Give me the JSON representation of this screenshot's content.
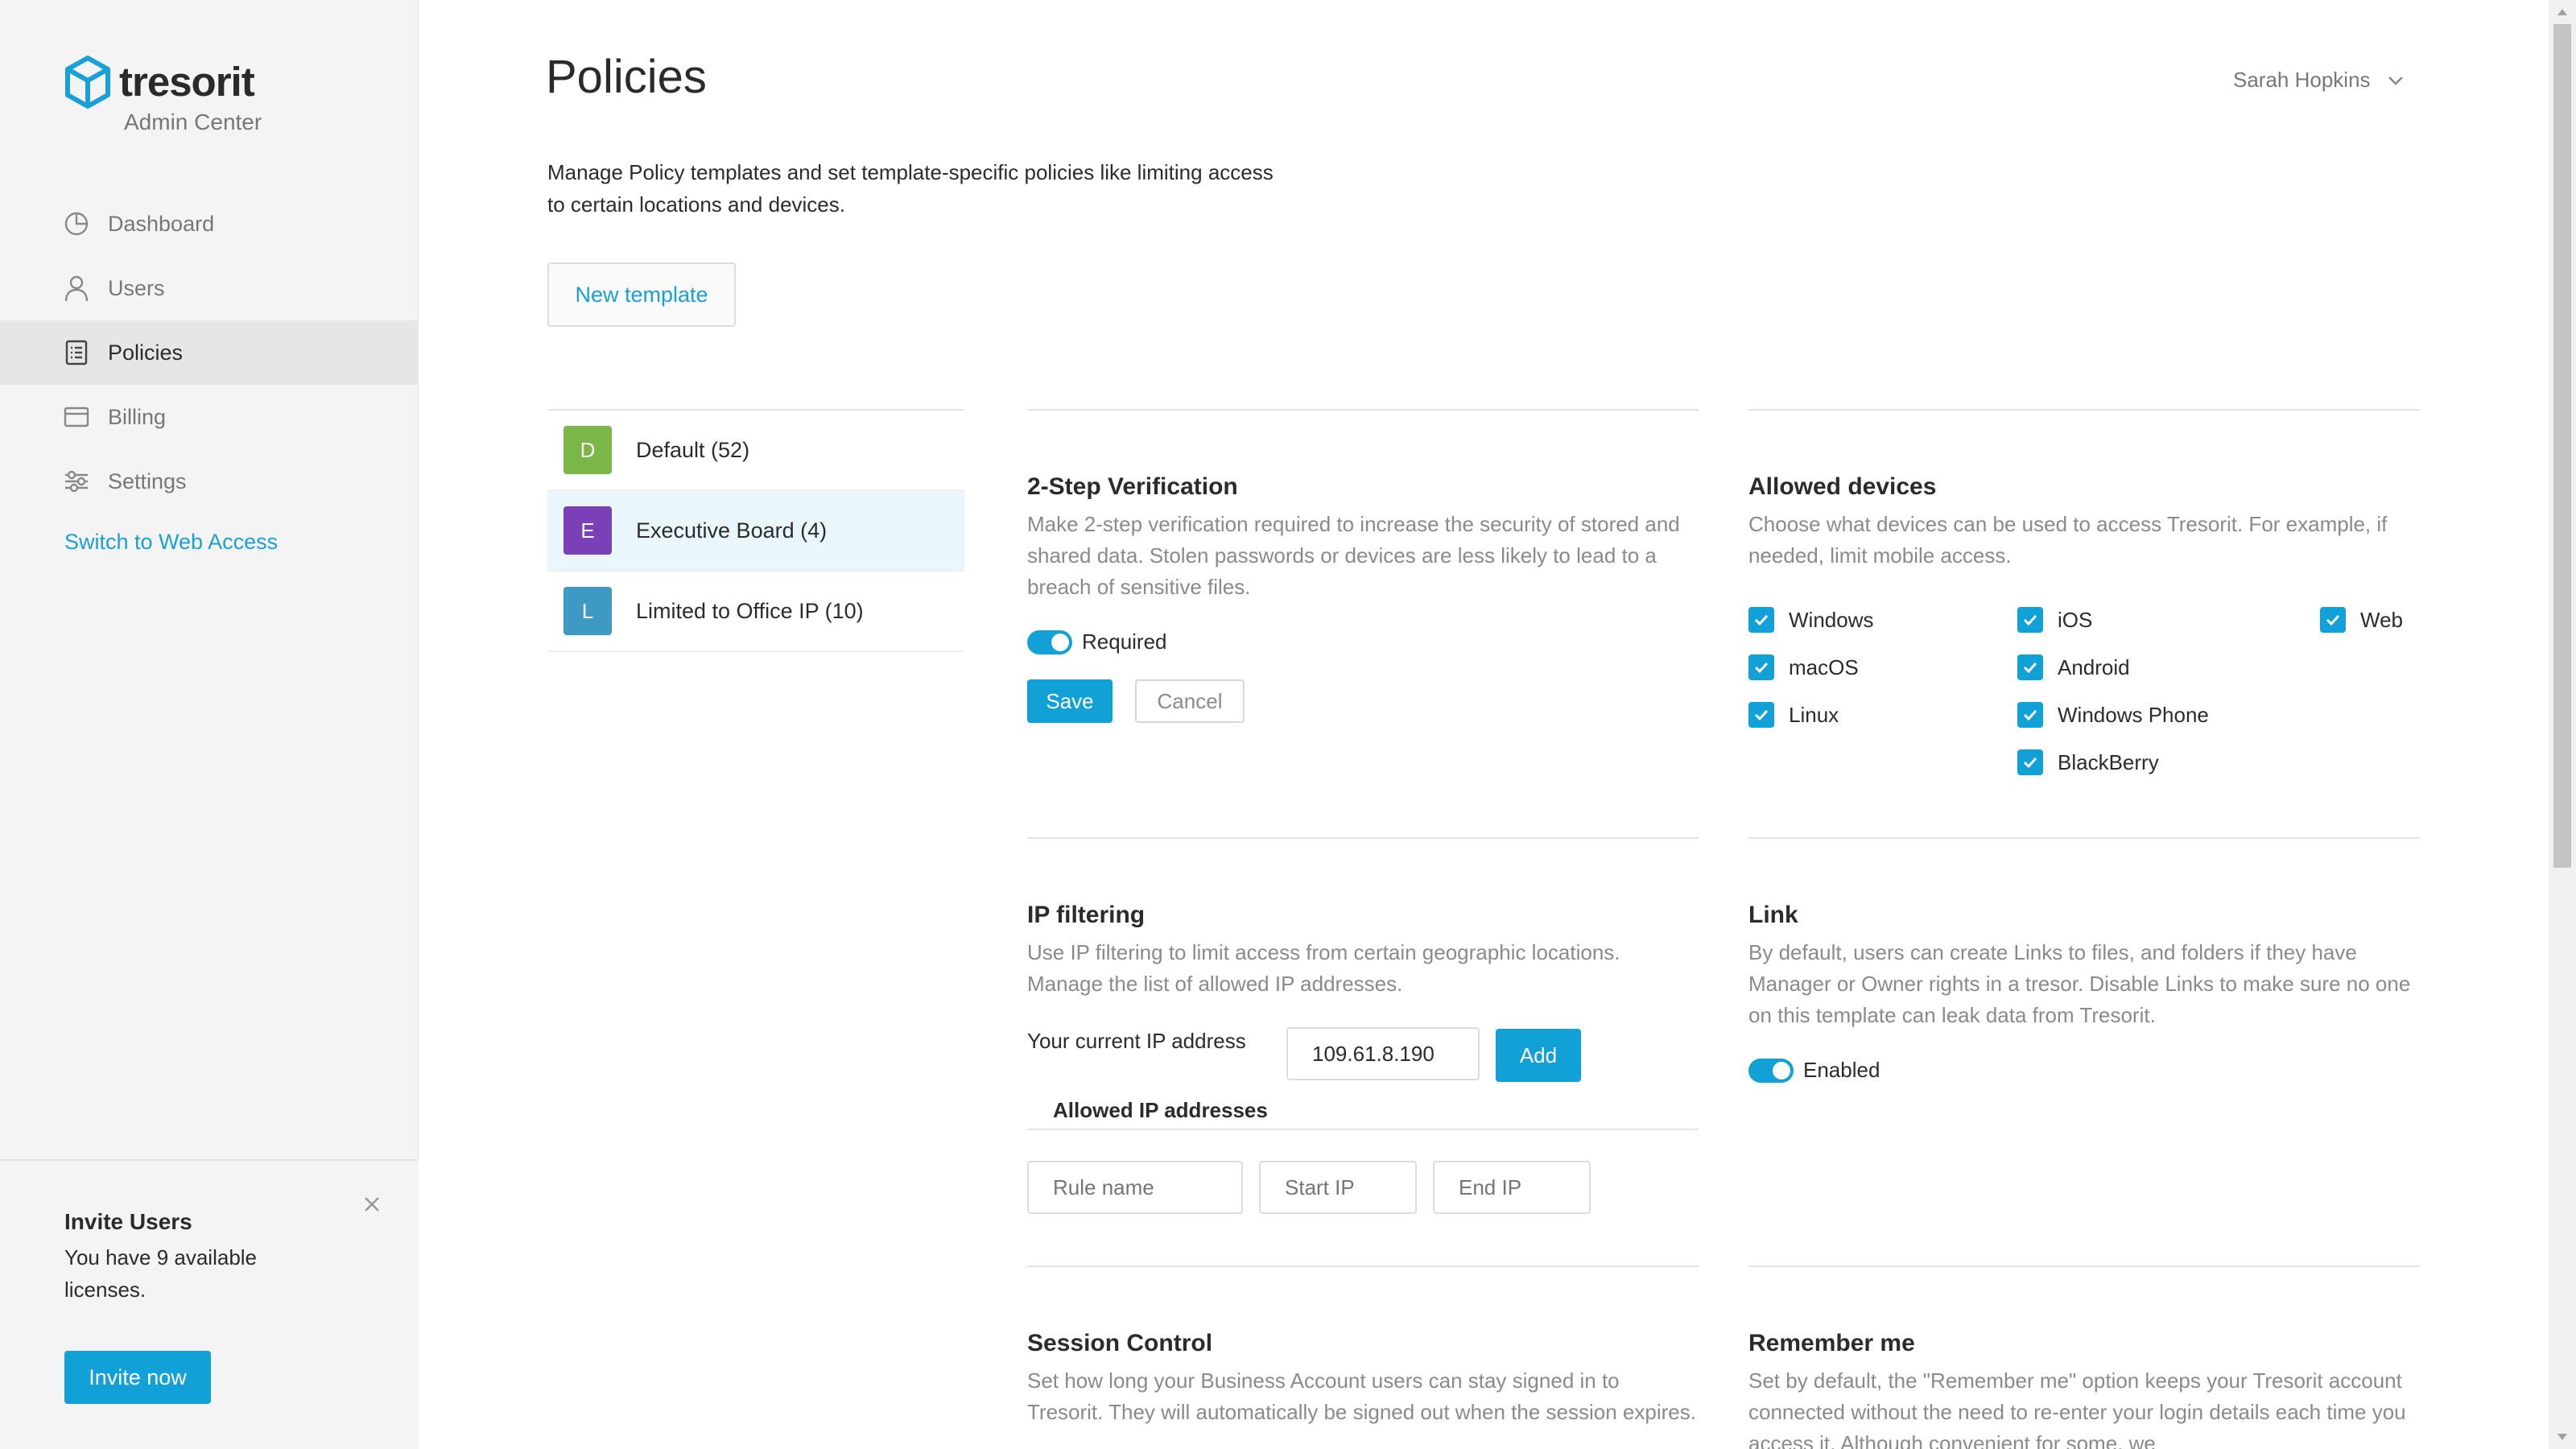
{
  "brand": {
    "name": "tresorit",
    "subtitle": "Admin Center",
    "color": "#1aa0d8"
  },
  "sidebar": {
    "items": [
      {
        "label": "Dashboard",
        "icon": "dashboard-icon",
        "active": false
      },
      {
        "label": "Users",
        "icon": "user-icon",
        "active": false
      },
      {
        "label": "Policies",
        "icon": "policies-icon",
        "active": true
      },
      {
        "label": "Billing",
        "icon": "credit-card-icon",
        "active": false
      },
      {
        "label": "Settings",
        "icon": "sliders-icon",
        "active": false
      }
    ],
    "web_access_link": "Switch to Web Access"
  },
  "invite": {
    "title": "Invite Users",
    "text": "You have 9 available licenses.",
    "button": "Invite now"
  },
  "header": {
    "title": "Policies",
    "user_name": "Sarah Hopkins"
  },
  "intro": "Manage Policy templates and set template-specific policies like limiting access to certain locations and devices.",
  "new_template_button": "New template",
  "templates": [
    {
      "letter": "D",
      "label": "Default (52)",
      "color": "#7ab648",
      "active": false
    },
    {
      "letter": "E",
      "label": "Executive Board (4)",
      "color": "#7b3fb8",
      "active": true
    },
    {
      "letter": "L",
      "label": "Limited to Office IP (10)",
      "color": "#3e9ac2",
      "active": false
    }
  ],
  "two_step": {
    "title": "2-Step Verification",
    "description": "Make 2-step verification required to increase the security of stored and shared data. Stolen passwords or devices are less likely to lead to a breach of sensitive files.",
    "toggle_label": "Required",
    "save": "Save",
    "cancel": "Cancel"
  },
  "allowed_devices": {
    "title": "Allowed devices",
    "description": "Choose what devices can be used to access Tresorit. For example, if needed, limit mobile access.",
    "devices": [
      {
        "label": "Windows",
        "checked": true
      },
      {
        "label": "macOS",
        "checked": true
      },
      {
        "label": "Linux",
        "checked": true
      },
      {
        "label": "iOS",
        "checked": true
      },
      {
        "label": "Android",
        "checked": true
      },
      {
        "label": "Windows Phone",
        "checked": true
      },
      {
        "label": "BlackBerry",
        "checked": true
      },
      {
        "label": "Web",
        "checked": true
      }
    ]
  },
  "ip_filtering": {
    "title": "IP filtering",
    "description": "Use IP filtering to limit access from certain geographic locations. Manage the list of allowed IP addresses.",
    "current_ip_label": "Your current IP address",
    "current_ip_value": "109.61.8.190",
    "add_button": "Add",
    "allowed_heading": "Allowed IP addresses",
    "rule_name_placeholder": "Rule name",
    "start_ip_placeholder": "Start IP",
    "end_ip_placeholder": "End IP"
  },
  "link": {
    "title": "Link",
    "description": "By default, users can create Links to files, and folders if they have Manager or Owner rights in a tresor. Disable Links to make sure no one on this template can leak data from Tresorit.",
    "toggle_label": "Enabled"
  },
  "session_control": {
    "title": "Session Control",
    "description": "Set how long your Business Account users can stay signed in to Tresorit. They will automatically be signed out when the session expires."
  },
  "remember_me": {
    "title": "Remember me",
    "description": "Set by default, the \"Remember me\" option keeps your Tresorit account connected without the need to re-enter your login details each time you access it. Although convenient for some, we"
  }
}
